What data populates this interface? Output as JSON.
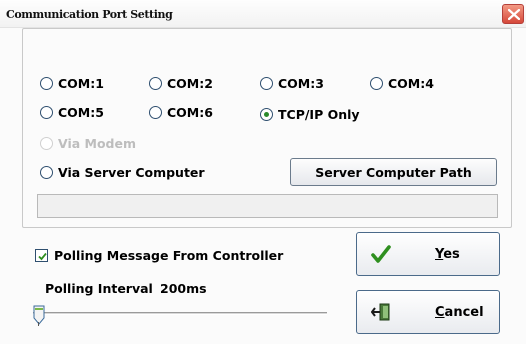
{
  "window": {
    "title": "Communication Port Setting",
    "close_icon": "close-icon"
  },
  "ports": {
    "options": [
      {
        "label": "COM:1",
        "checked": false
      },
      {
        "label": "COM:2",
        "checked": false
      },
      {
        "label": "COM:3",
        "checked": false
      },
      {
        "label": "COM:4",
        "checked": false
      },
      {
        "label": "COM:5",
        "checked": false
      },
      {
        "label": "COM:6",
        "checked": false
      },
      {
        "label": "TCP/IP Only",
        "checked": true
      }
    ],
    "via_modem": {
      "label": "Via Modem",
      "enabled": false
    },
    "via_server": {
      "label": "Via Server Computer",
      "checked": false
    },
    "server_path_button": "Server Computer Path",
    "server_path_value": ""
  },
  "polling": {
    "checkbox_label": "Polling Message From Controller",
    "checked": true,
    "interval_label": "Polling Interval",
    "interval_value": "200ms",
    "slider_fraction": 0.0
  },
  "buttons": {
    "yes": {
      "mnemonic": "Y",
      "rest": "es",
      "icon": "checkmark-icon"
    },
    "cancel": {
      "mnemonic": "C",
      "rest": "ancel",
      "icon": "exit-door-icon"
    }
  },
  "colors": {
    "check_green": "#2f8f1f",
    "close_red": "#d5483a"
  }
}
